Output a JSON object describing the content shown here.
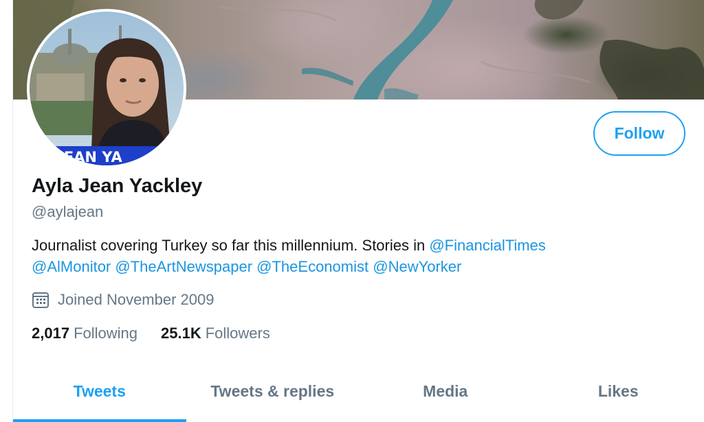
{
  "profile": {
    "display_name": "Ayla Jean Yackley",
    "handle": "@aylajean",
    "avatar_caption": "JEAN YA",
    "follow_label": "Follow",
    "bio": {
      "text_before": "Journalist covering Turkey so far this millennium. Stories in ",
      "mentions": [
        "@FinancialTimes",
        "@AlMonitor",
        "@TheArtNewspaper",
        "@TheEconomist",
        "@NewYorker"
      ]
    },
    "joined": "Joined November 2009",
    "joined_icon": "calendar-icon",
    "stats": {
      "following_count": "2,017",
      "following_label": "Following",
      "followers_count": "25.1K",
      "followers_label": "Followers"
    }
  },
  "tabs": [
    {
      "label": "Tweets",
      "active": true
    },
    {
      "label": "Tweets & replies",
      "active": false
    },
    {
      "label": "Media",
      "active": false
    },
    {
      "label": "Likes",
      "active": false
    }
  ],
  "colors": {
    "accent": "#1da1f2",
    "mention": "#1b95e0",
    "secondary_text": "#657786",
    "primary_text": "#14171a"
  }
}
